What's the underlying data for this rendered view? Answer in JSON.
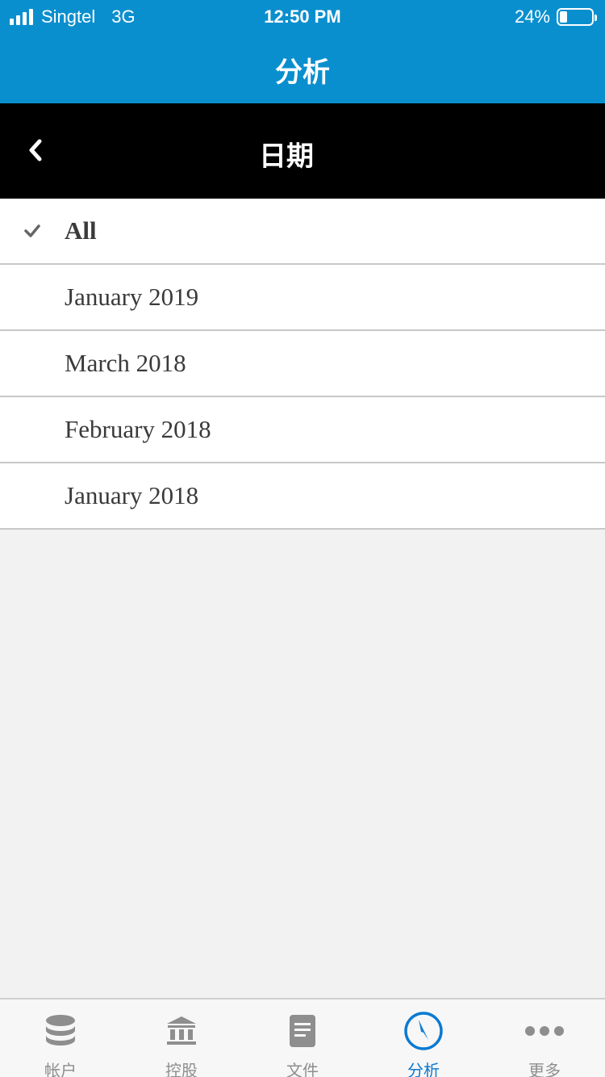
{
  "status_bar": {
    "carrier": "Singtel",
    "network": "3G",
    "time": "12:50 PM",
    "battery": "24%",
    "battery_level": 0.24
  },
  "nav": {
    "title": "分析"
  },
  "subheader": {
    "title": "日期"
  },
  "list": {
    "items": [
      {
        "label": "All",
        "selected": true
      },
      {
        "label": "January 2019",
        "selected": false
      },
      {
        "label": "March 2018",
        "selected": false
      },
      {
        "label": "February 2018",
        "selected": false
      },
      {
        "label": "January 2018",
        "selected": false
      }
    ]
  },
  "tabbar": {
    "items": [
      {
        "label": "帐户",
        "icon": "database-icon"
      },
      {
        "label": "控股",
        "icon": "bank-icon"
      },
      {
        "label": "文件",
        "icon": "document-icon"
      },
      {
        "label": "分析",
        "icon": "compass-icon",
        "active": true
      },
      {
        "label": "更多",
        "icon": "more-icon"
      }
    ]
  },
  "colors": {
    "nav_bg": "#0a8fce",
    "subheader_bg": "#000000",
    "active_tab": "#0a7ad2",
    "inactive_tab": "#8e8e8e"
  }
}
